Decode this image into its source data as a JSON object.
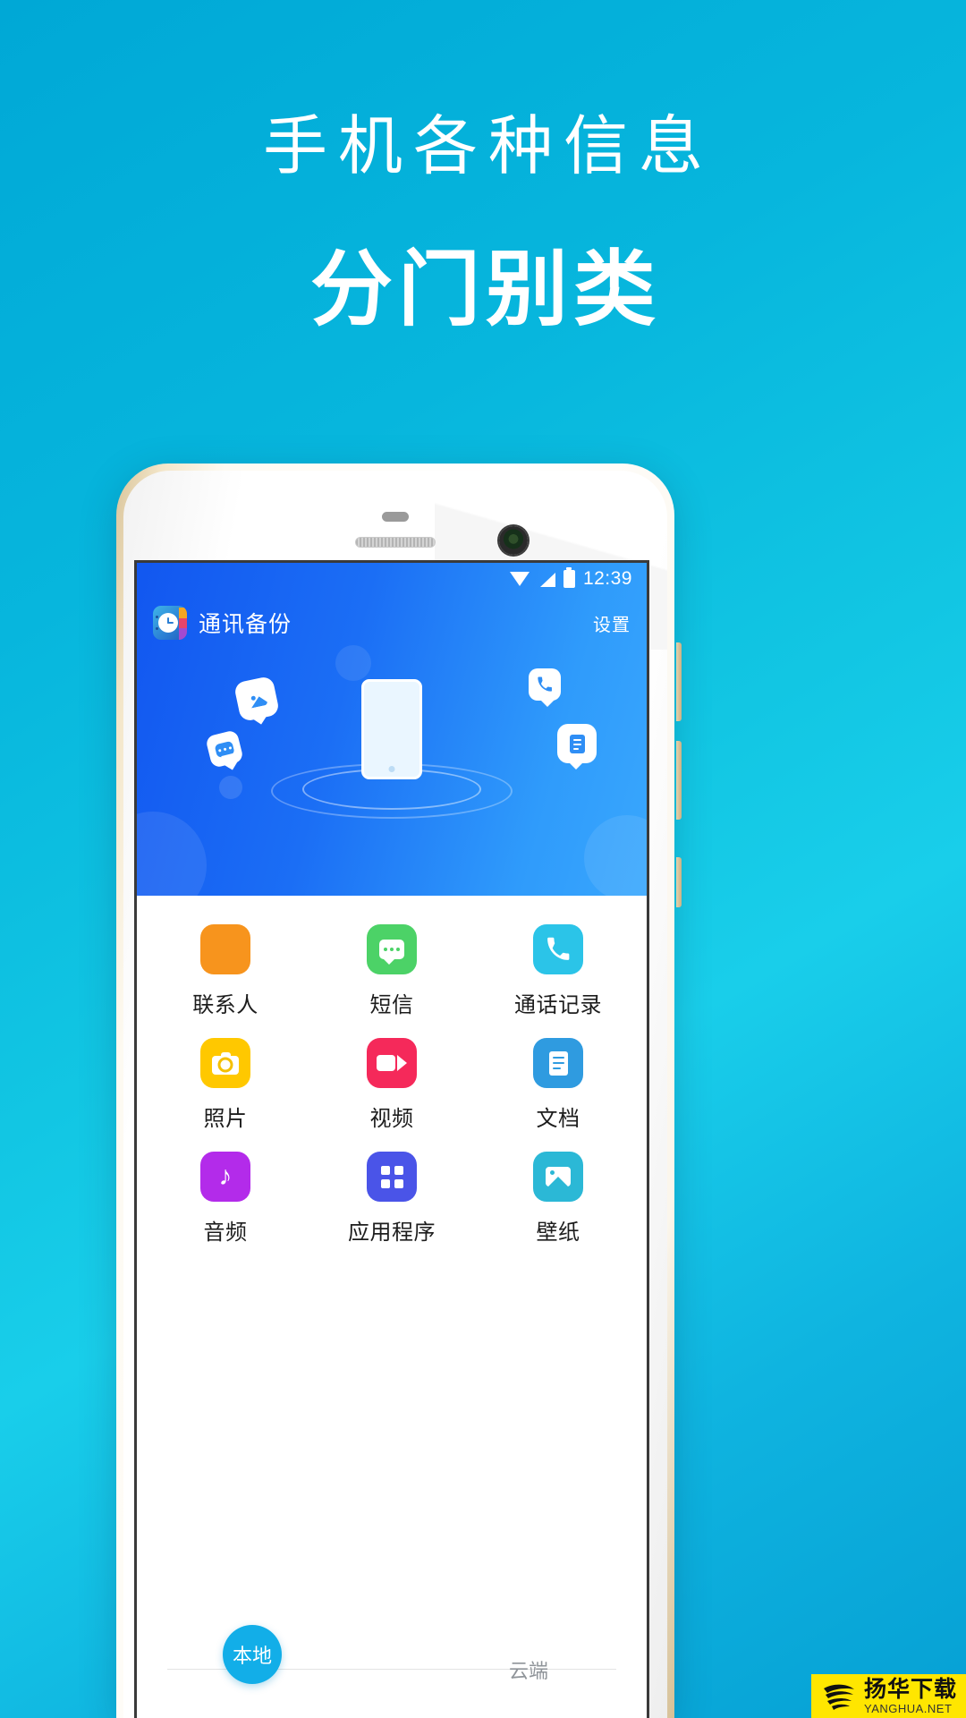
{
  "promo": {
    "line1": "手机各种信息",
    "line2": "分门别类"
  },
  "theme": {
    "bg_gradient_start": "#00a8d6",
    "bg_gradient_end": "#19ceea",
    "app_header_start": "#1257f0",
    "app_header_end": "#39a7fd",
    "accent": "#12aee8"
  },
  "phone": {
    "statusbar": {
      "time": "12:39",
      "icons": [
        "wifi-icon",
        "signal-icon",
        "battery-icon"
      ]
    },
    "appbar": {
      "app_icon": "contacts-clock-icon",
      "title": "通讯备份",
      "settings_label": "设置"
    },
    "hero": {
      "device_icon": "smartphone-illustration",
      "chips": [
        "image-chip-icon",
        "sms-chip-icon",
        "call-chip-icon",
        "document-chip-icon"
      ]
    },
    "grid": [
      {
        "label": "联系人",
        "icon": "contacts-icon",
        "color": "#F7941D"
      },
      {
        "label": "短信",
        "icon": "message-icon",
        "color": "#4CD267"
      },
      {
        "label": "通话记录",
        "icon": "call-log-icon",
        "color": "#2BC4E8"
      },
      {
        "label": "照片",
        "icon": "camera-icon",
        "color": "#FFC800"
      },
      {
        "label": "视频",
        "icon": "video-icon",
        "color": "#F5295A"
      },
      {
        "label": "文档",
        "icon": "document-icon",
        "color": "#2F9BE0"
      },
      {
        "label": "音频",
        "icon": "music-icon",
        "color": "#B32BEA"
      },
      {
        "label": "应用程序",
        "icon": "apps-grid-icon",
        "color": "#4A54E8"
      },
      {
        "label": "壁纸",
        "icon": "wallpaper-icon",
        "color": "#2BB8D6"
      }
    ],
    "tabs": {
      "local": "本地",
      "cloud": "云端"
    }
  },
  "watermark": {
    "cn": "扬华下载",
    "en": "YANGHUA.NET"
  }
}
